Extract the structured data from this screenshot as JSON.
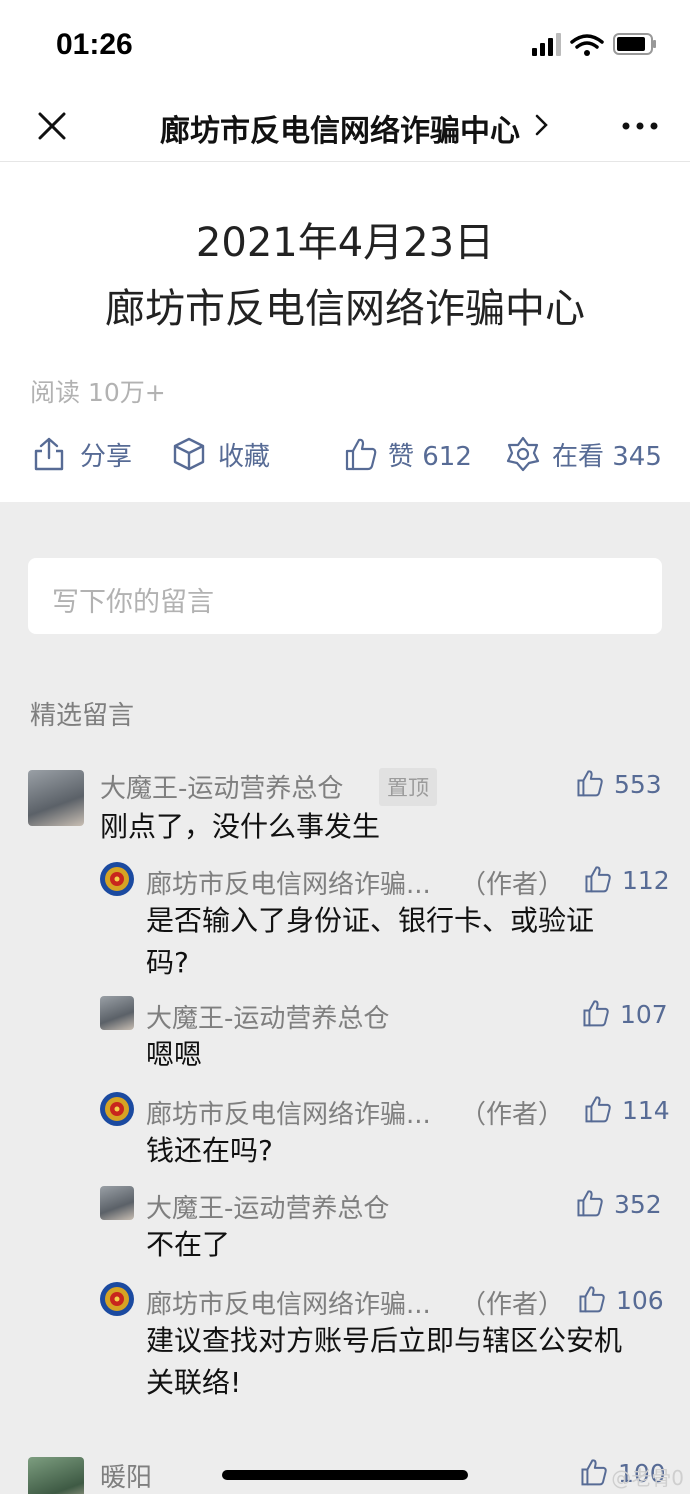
{
  "status": {
    "time": "01:26"
  },
  "nav": {
    "title": "廊坊市反电信网络诈骗中心"
  },
  "article": {
    "line1": "2021年4月23日",
    "line2": "廊坊市反电信网络诈骗中心",
    "read_count": "阅读 10万+"
  },
  "actions": {
    "share": "分享",
    "favorite": "收藏",
    "like": "赞 612",
    "watching": "在看 345"
  },
  "comment_input": {
    "placeholder": "写下你的留言"
  },
  "comments_section": {
    "title": "精选留言"
  },
  "comments": [
    {
      "name": "大魔王-运动营养总仓",
      "badge": "置顶",
      "likes": "553",
      "text": "刚点了，没什么事发生"
    },
    {
      "name": "廊坊市反电信网络诈骗...",
      "author_tag": "（作者）",
      "likes": "112",
      "text_line1": "是否输入了身份证、银行卡、或验证",
      "text_line2": "码?"
    },
    {
      "name": "大魔王-运动营养总仓",
      "likes": "107",
      "text": "嗯嗯"
    },
    {
      "name": "廊坊市反电信网络诈骗...",
      "author_tag": "（作者）",
      "likes": "114",
      "text": "钱还在吗?"
    },
    {
      "name": "大魔王-运动营养总仓",
      "likes": "352",
      "text": "不在了"
    },
    {
      "name": "廊坊市反电信网络诈骗...",
      "author_tag": "（作者）",
      "likes": "106",
      "text_line1": "建议查找对方账号后立即与辖区公安机",
      "text_line2": "关联络!"
    },
    {
      "name": "暖阳",
      "likes": "100"
    }
  ],
  "watermark": "@老骨0"
}
